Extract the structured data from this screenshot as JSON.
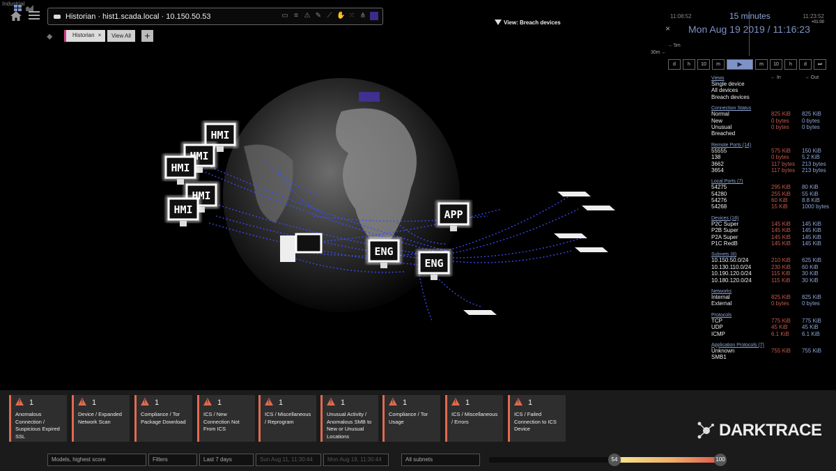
{
  "app": {
    "corner_label": "Industrial"
  },
  "search": {
    "value": "Historian · hist1.scada.local · 10.150.50.53"
  },
  "tags": {
    "chip_label": "Historian",
    "chip_close": "×",
    "view_all": "View All",
    "add": "+"
  },
  "view_filter": "View: Breach devices",
  "time": {
    "start": "11:08:52",
    "end": "11:23:52",
    "range": "15 minutes",
    "offset": "+01:00",
    "date": "Mon Aug 19 2019 / 11:16:23",
    "close": "×",
    "m5": "5m",
    "m30": "30m",
    "buttons": [
      "d",
      "h",
      "10",
      "m",
      "▶",
      "m",
      "10",
      "h",
      "d",
      "⏭"
    ]
  },
  "stats": {
    "in_label": "In",
    "out_label": "Out",
    "views": {
      "header": "Views",
      "items": [
        "Single device",
        "All devices",
        "Breach devices"
      ]
    },
    "sections": [
      {
        "header": "Connection Status",
        "rows": [
          [
            "Normal",
            "825 KiB",
            "825 KiB"
          ],
          [
            "New",
            "0 bytes",
            "0 bytes"
          ],
          [
            "Unusual",
            "0 bytes",
            "0 bytes"
          ],
          [
            "Breached",
            "",
            ""
          ]
        ]
      },
      {
        "header": "Remote Ports (14)",
        "rows": [
          [
            "55555",
            "575 KiB",
            "150 KiB"
          ],
          [
            "138",
            "0 bytes",
            "5.2 KiB"
          ],
          [
            "3662",
            "117 bytes",
            "213 bytes"
          ],
          [
            "3654",
            "117 bytes",
            "213 bytes"
          ]
        ]
      },
      {
        "header": "Local Ports (7)",
        "rows": [
          [
            "54275",
            "295 KiB",
            "80 KiB"
          ],
          [
            "54280",
            "255 KiB",
            "55 KiB"
          ],
          [
            "54276",
            "60 KiB",
            "8.8 KiB"
          ],
          [
            "54268",
            "15 KiB",
            "1000 bytes"
          ]
        ]
      },
      {
        "header": "Devices (18)",
        "rows": [
          [
            "P2C Super",
            "145 KiB",
            "145 KiB"
          ],
          [
            "P2B Super",
            "145 KiB",
            "145 KiB"
          ],
          [
            "P2A Super",
            "145 KiB",
            "145 KiB"
          ],
          [
            "P1C RedB",
            "145 KiB",
            "145 KiB"
          ]
        ]
      },
      {
        "header": "Subnets (8)",
        "rows": [
          [
            "10.150.50.0/24",
            "210 KiB",
            "625 KiB"
          ],
          [
            "10.130.110.0/24",
            "230 KiB",
            "60 KiB"
          ],
          [
            "10.190.120.0/24",
            "115 KiB",
            "30 KiB"
          ],
          [
            "10.180.120.0/24",
            "115 KiB",
            "30 KiB"
          ]
        ]
      },
      {
        "header": "Networks",
        "rows": [
          [
            "Internal",
            "825 KiB",
            "825 KiB"
          ],
          [
            "External",
            "0 bytes",
            "0 bytes"
          ]
        ]
      },
      {
        "header": "Protocols",
        "rows": [
          [
            "TCP",
            "775 KiB",
            "775 KiB"
          ],
          [
            "UDP",
            "45 KiB",
            "45 KiB"
          ],
          [
            "ICMP",
            "6.1 KiB",
            "6.1 KiB"
          ]
        ]
      },
      {
        "header": "Application Protocols (7)",
        "rows": [
          [
            "Unknown",
            "755 KiB",
            "755 KiB"
          ],
          [
            "SMB1",
            "",
            ""
          ]
        ]
      }
    ]
  },
  "viz": {
    "labels": [
      "HMI",
      "HMI",
      "HMI",
      "HMI",
      "HMI",
      "APP",
      "ENG",
      "ENG"
    ]
  },
  "alerts": [
    {
      "count": "1",
      "lines": [
        "Anomalous",
        "Connection /",
        "Suspicious Expired",
        "SSL"
      ]
    },
    {
      "count": "1",
      "lines": [
        "Device / Expanded",
        "Network Scan"
      ]
    },
    {
      "count": "1",
      "lines": [
        "Compliance / Tor",
        "Package Download"
      ]
    },
    {
      "count": "1",
      "lines": [
        "ICS / New",
        "Connection Not",
        "From ICS"
      ]
    },
    {
      "count": "1",
      "lines": [
        "ICS / Miscellaneous",
        "/ Reprogram"
      ]
    },
    {
      "count": "1",
      "lines": [
        "Unusual Activity /",
        "Anomalous SMB to",
        "New or Unusual",
        "Locations"
      ]
    },
    {
      "count": "1",
      "lines": [
        "Compliance / Tor",
        "Usage"
      ]
    },
    {
      "count": "1",
      "lines": [
        "ICS / Miscellaneous",
        "/ Errors"
      ]
    },
    {
      "count": "1",
      "lines": [
        "ICS / Failed",
        "Connection to ICS",
        "Device"
      ]
    }
  ],
  "brand": "DARKTRACE",
  "bottom": {
    "sort": "Models, highest score",
    "filters": "Filters",
    "period": "Last 7 days",
    "from": "Sun Aug 11, 11:30:44",
    "to": "Mon Aug 19, 11:30:44",
    "subnets": "All subnets",
    "score_min": "54",
    "score_max": "100"
  },
  "colors": {
    "accent": "#7d93c8",
    "alert": "#e06a50",
    "in": "#c45a4a",
    "out": "#8ea6d8",
    "traffic": "#3a4dff"
  }
}
